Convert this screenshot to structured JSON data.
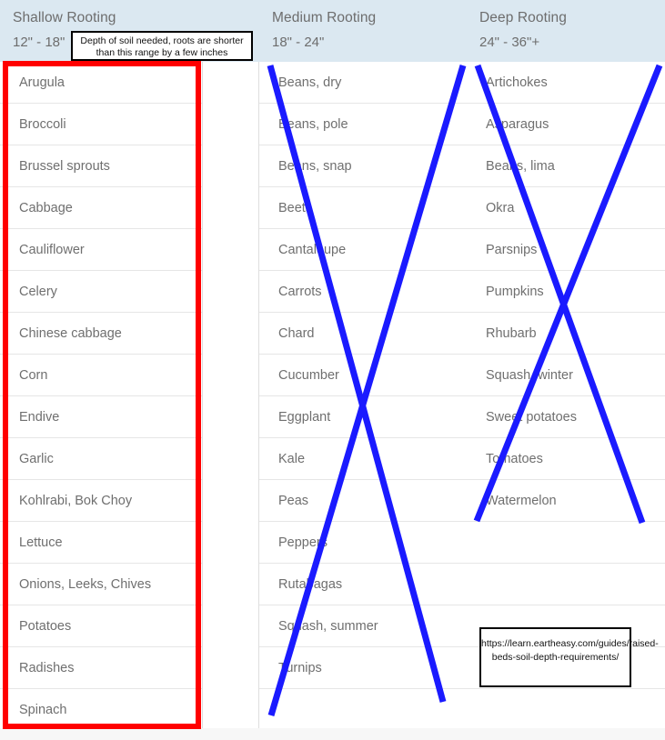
{
  "columns": [
    {
      "title": "Shallow Rooting",
      "range": "12\" - 18\"",
      "highlighted": true,
      "crossed_out": false,
      "items": [
        "Arugula",
        "Broccoli",
        "Brussel sprouts",
        "Cabbage",
        "Cauliflower",
        "Celery",
        "Chinese cabbage",
        "Corn",
        "Endive",
        "Garlic",
        "Kohlrabi, Bok Choy",
        "Lettuce",
        "Onions, Leeks, Chives",
        "Potatoes",
        "Radishes",
        "Spinach"
      ]
    },
    {
      "title": "Medium Rooting",
      "range": "18\" - 24\"",
      "highlighted": false,
      "crossed_out": true,
      "items": [
        "Beans, dry",
        "Beans, pole",
        "Beans, snap",
        "Beets",
        "Cantaloupe",
        "Carrots",
        "Chard",
        "Cucumber",
        "Eggplant",
        "Kale",
        "Peas",
        "Peppers",
        "Rutabagas",
        "Squash, summer",
        "Turnips",
        ""
      ]
    },
    {
      "title": "Deep Rooting",
      "range": "24\" - 36\"+",
      "highlighted": false,
      "crossed_out": true,
      "items": [
        "Artichokes",
        "Asparagus",
        "Beans, lima",
        "Okra",
        "Parsnips",
        "Pumpkins",
        "Rhubarb",
        "Squash, winter",
        "Sweet potatoes",
        "Tomatoes",
        "Watermelon",
        "",
        "",
        "",
        "",
        ""
      ]
    }
  ],
  "annotations": {
    "tooltip_text": "Depth of soil needed, roots are shorter than this range by a few inches",
    "source_url": "https://learn.eartheasy.com/guides/raised-beds-soil-depth-requirements/",
    "highlight_color": "#ff0000",
    "strike_color": "#1a1aff",
    "header_background": "#dbe8f1",
    "text_color": "#6f6f6f"
  }
}
